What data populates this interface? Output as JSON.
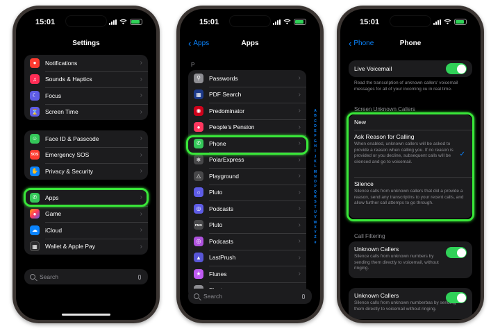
{
  "status": {
    "time": "15:01"
  },
  "colors": {
    "accent": "#0a84ff",
    "toggle_on": "#30d158",
    "highlight": "#39e639",
    "group_bg": "#1c1c1e"
  },
  "phone1": {
    "title": "Settings",
    "group1": [
      {
        "label": "Notifications",
        "icon": "bell-icon",
        "color": "#ff3b30"
      },
      {
        "label": "Sounds & Haptics",
        "icon": "speaker-icon",
        "color": "#ff2d55"
      },
      {
        "label": "Focus",
        "icon": "moon-icon",
        "color": "#5e5ce6"
      },
      {
        "label": "Screen Time",
        "icon": "hourglass-icon",
        "color": "#5e5ce6"
      }
    ],
    "group2": [
      {
        "label": "Face ID & Passcode",
        "icon": "faceid-icon",
        "color": "#34c759"
      },
      {
        "label": "Emergency SOS",
        "icon": "sos-icon",
        "color": "#ff3b30"
      },
      {
        "label": "Privacy & Security",
        "icon": "hand-icon",
        "color": "#0a84ff"
      }
    ],
    "group3": [
      {
        "label": "Apps",
        "icon": "phone-icon",
        "color": "#34c759"
      },
      {
        "label": "Game",
        "icon": "game-icon",
        "color": "#ff9f0a"
      },
      {
        "label": "iCloud",
        "icon": "cloud-icon",
        "color": "#0a84ff"
      },
      {
        "label": "Wallet & Apple Pay",
        "icon": "wallet-icon",
        "color": "#1c1c1e"
      }
    ],
    "search_placeholder": "Search"
  },
  "phone2": {
    "back_label": "Apps",
    "title": "Apps",
    "section_letter": "P",
    "apps": [
      {
        "label": "Passwords",
        "icon": "key-icon",
        "color": "#8e8e93"
      },
      {
        "label": "PDF Search",
        "icon": "pdf-icon",
        "color": "#1d3a8a"
      },
      {
        "label": "Predominator",
        "icon": "target-icon",
        "color": "#d0021b"
      },
      {
        "label": "People's Pension",
        "icon": "pension-icon",
        "color": "#ff375f"
      },
      {
        "label": "Phone",
        "icon": "phone-icon",
        "color": "#34c759"
      },
      {
        "label": "PolarExpress",
        "icon": "polar-icon",
        "color": "#48484a"
      },
      {
        "label": "Playground",
        "icon": "playground-icon",
        "color": "#48484a"
      },
      {
        "label": "Pluto",
        "icon": "planet-icon",
        "color": "#5e5ce6"
      },
      {
        "label": "Podcasts",
        "icon": "podcast-icon",
        "color": "#5e5ce6"
      },
      {
        "label": "Pluto",
        "icon": "pmg-icon",
        "color": "#48484a"
      },
      {
        "label": "Podcasts",
        "icon": "podcast-icon",
        "color": "#af52de"
      },
      {
        "label": "LastPrush",
        "icon": "lastprush-icon",
        "color": "#5856d6"
      },
      {
        "label": "Flunes",
        "icon": "flunes-icon",
        "color": "#bf5af2"
      },
      {
        "label": "Float",
        "icon": "float-icon",
        "color": "#8e8e93"
      }
    ],
    "index_letters": [
      "A",
      "B",
      "C",
      "D",
      "E",
      "F",
      "G",
      "H",
      "I",
      "J",
      "K",
      "L",
      "M",
      "N",
      "O",
      "P",
      "Q",
      "R",
      "S",
      "T",
      "U",
      "V",
      "W",
      "X",
      "Y",
      "Z",
      "#"
    ],
    "search_placeholder": "Search"
  },
  "phone3": {
    "back_label": "Phone",
    "title": "Phone",
    "live_voicemail": {
      "title": "Live Voicemail",
      "desc": "Read the transcription of unknown callers' voicemail messages for all of your incoming cu in real time."
    },
    "screen_header": "Screen Unknown Callers",
    "options": [
      {
        "title": "New",
        "desc": ""
      },
      {
        "title": "Ask Reason for Calling",
        "desc": "When enabled, unknown callers will be asked to provide a reason when calling you. If no reason is provided or you decline, subsequent calls will be silenced and go to voicemail.",
        "checked": true
      },
      {
        "title": "Silence",
        "desc": "Silence calls from unknown callers that did a provide a reason, send any transcriptins to your recent calls, and allow further call attemps to go through."
      }
    ],
    "check_mark": "✓",
    "filter_header": "Call Filtering",
    "filter1": {
      "title": "Unknown Callers",
      "desc": "Silence calls from unknown numbers by sending them directly to voicemail, without ringing."
    },
    "filter2": {
      "title": "Unknown Callers",
      "desc": "Silence calls from unknown numberbas by sending them directly to voicemail without ringing."
    }
  }
}
